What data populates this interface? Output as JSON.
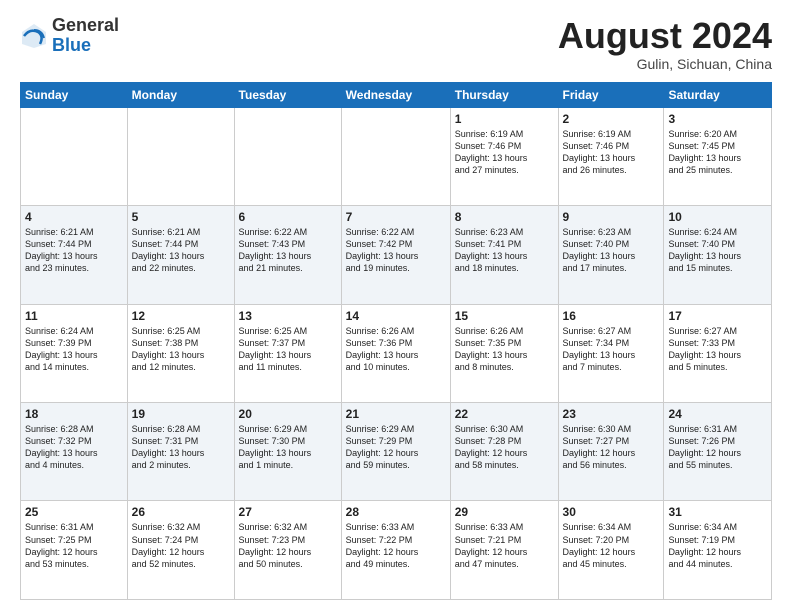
{
  "header": {
    "logo_general": "General",
    "logo_blue": "Blue",
    "month_title": "August 2024",
    "subtitle": "Gulin, Sichuan, China"
  },
  "weekdays": [
    "Sunday",
    "Monday",
    "Tuesday",
    "Wednesday",
    "Thursday",
    "Friday",
    "Saturday"
  ],
  "weeks": [
    [
      {
        "day": "",
        "info": ""
      },
      {
        "day": "",
        "info": ""
      },
      {
        "day": "",
        "info": ""
      },
      {
        "day": "",
        "info": ""
      },
      {
        "day": "1",
        "info": "Sunrise: 6:19 AM\nSunset: 7:46 PM\nDaylight: 13 hours\nand 27 minutes."
      },
      {
        "day": "2",
        "info": "Sunrise: 6:19 AM\nSunset: 7:46 PM\nDaylight: 13 hours\nand 26 minutes."
      },
      {
        "day": "3",
        "info": "Sunrise: 6:20 AM\nSunset: 7:45 PM\nDaylight: 13 hours\nand 25 minutes."
      }
    ],
    [
      {
        "day": "4",
        "info": "Sunrise: 6:21 AM\nSunset: 7:44 PM\nDaylight: 13 hours\nand 23 minutes."
      },
      {
        "day": "5",
        "info": "Sunrise: 6:21 AM\nSunset: 7:44 PM\nDaylight: 13 hours\nand 22 minutes."
      },
      {
        "day": "6",
        "info": "Sunrise: 6:22 AM\nSunset: 7:43 PM\nDaylight: 13 hours\nand 21 minutes."
      },
      {
        "day": "7",
        "info": "Sunrise: 6:22 AM\nSunset: 7:42 PM\nDaylight: 13 hours\nand 19 minutes."
      },
      {
        "day": "8",
        "info": "Sunrise: 6:23 AM\nSunset: 7:41 PM\nDaylight: 13 hours\nand 18 minutes."
      },
      {
        "day": "9",
        "info": "Sunrise: 6:23 AM\nSunset: 7:40 PM\nDaylight: 13 hours\nand 17 minutes."
      },
      {
        "day": "10",
        "info": "Sunrise: 6:24 AM\nSunset: 7:40 PM\nDaylight: 13 hours\nand 15 minutes."
      }
    ],
    [
      {
        "day": "11",
        "info": "Sunrise: 6:24 AM\nSunset: 7:39 PM\nDaylight: 13 hours\nand 14 minutes."
      },
      {
        "day": "12",
        "info": "Sunrise: 6:25 AM\nSunset: 7:38 PM\nDaylight: 13 hours\nand 12 minutes."
      },
      {
        "day": "13",
        "info": "Sunrise: 6:25 AM\nSunset: 7:37 PM\nDaylight: 13 hours\nand 11 minutes."
      },
      {
        "day": "14",
        "info": "Sunrise: 6:26 AM\nSunset: 7:36 PM\nDaylight: 13 hours\nand 10 minutes."
      },
      {
        "day": "15",
        "info": "Sunrise: 6:26 AM\nSunset: 7:35 PM\nDaylight: 13 hours\nand 8 minutes."
      },
      {
        "day": "16",
        "info": "Sunrise: 6:27 AM\nSunset: 7:34 PM\nDaylight: 13 hours\nand 7 minutes."
      },
      {
        "day": "17",
        "info": "Sunrise: 6:27 AM\nSunset: 7:33 PM\nDaylight: 13 hours\nand 5 minutes."
      }
    ],
    [
      {
        "day": "18",
        "info": "Sunrise: 6:28 AM\nSunset: 7:32 PM\nDaylight: 13 hours\nand 4 minutes."
      },
      {
        "day": "19",
        "info": "Sunrise: 6:28 AM\nSunset: 7:31 PM\nDaylight: 13 hours\nand 2 minutes."
      },
      {
        "day": "20",
        "info": "Sunrise: 6:29 AM\nSunset: 7:30 PM\nDaylight: 13 hours\nand 1 minute."
      },
      {
        "day": "21",
        "info": "Sunrise: 6:29 AM\nSunset: 7:29 PM\nDaylight: 12 hours\nand 59 minutes."
      },
      {
        "day": "22",
        "info": "Sunrise: 6:30 AM\nSunset: 7:28 PM\nDaylight: 12 hours\nand 58 minutes."
      },
      {
        "day": "23",
        "info": "Sunrise: 6:30 AM\nSunset: 7:27 PM\nDaylight: 12 hours\nand 56 minutes."
      },
      {
        "day": "24",
        "info": "Sunrise: 6:31 AM\nSunset: 7:26 PM\nDaylight: 12 hours\nand 55 minutes."
      }
    ],
    [
      {
        "day": "25",
        "info": "Sunrise: 6:31 AM\nSunset: 7:25 PM\nDaylight: 12 hours\nand 53 minutes."
      },
      {
        "day": "26",
        "info": "Sunrise: 6:32 AM\nSunset: 7:24 PM\nDaylight: 12 hours\nand 52 minutes."
      },
      {
        "day": "27",
        "info": "Sunrise: 6:32 AM\nSunset: 7:23 PM\nDaylight: 12 hours\nand 50 minutes."
      },
      {
        "day": "28",
        "info": "Sunrise: 6:33 AM\nSunset: 7:22 PM\nDaylight: 12 hours\nand 49 minutes."
      },
      {
        "day": "29",
        "info": "Sunrise: 6:33 AM\nSunset: 7:21 PM\nDaylight: 12 hours\nand 47 minutes."
      },
      {
        "day": "30",
        "info": "Sunrise: 6:34 AM\nSunset: 7:20 PM\nDaylight: 12 hours\nand 45 minutes."
      },
      {
        "day": "31",
        "info": "Sunrise: 6:34 AM\nSunset: 7:19 PM\nDaylight: 12 hours\nand 44 minutes."
      }
    ]
  ]
}
